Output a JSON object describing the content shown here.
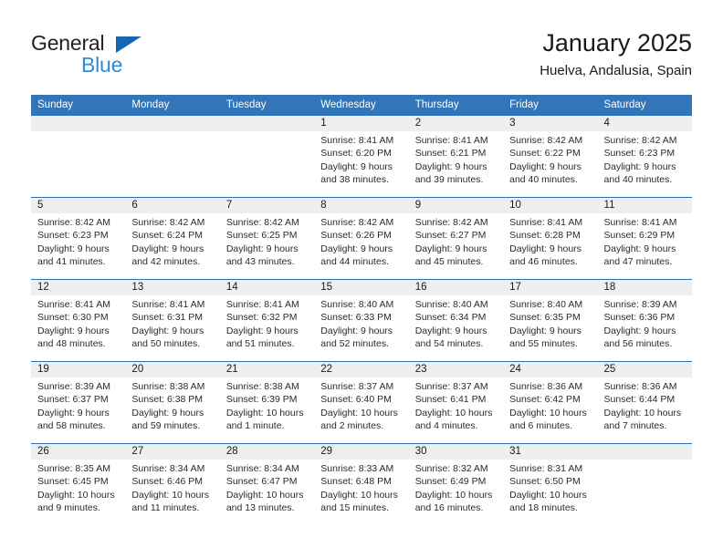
{
  "logo": {
    "primary_text": "General",
    "secondary_text": "Blue",
    "primary_color": "#231f20",
    "secondary_color": "#2e8bd4",
    "triangle_color": "#1567b3",
    "triangle_name": "blue-triangle-icon"
  },
  "header": {
    "title": "January 2025",
    "subtitle": "Huelva, Andalusia, Spain"
  },
  "colors": {
    "header_band": "#3275b8",
    "week_divider": "#2f6fae",
    "day_number_band": "#efefef"
  },
  "weekdays": [
    "Sunday",
    "Monday",
    "Tuesday",
    "Wednesday",
    "Thursday",
    "Friday",
    "Saturday"
  ],
  "weeks": [
    [
      {
        "day": "",
        "empty": true,
        "sunrise": "",
        "sunset": "",
        "daylight_line1": "",
        "daylight_line2": ""
      },
      {
        "day": "",
        "empty": true,
        "sunrise": "",
        "sunset": "",
        "daylight_line1": "",
        "daylight_line2": ""
      },
      {
        "day": "",
        "empty": true,
        "sunrise": "",
        "sunset": "",
        "daylight_line1": "",
        "daylight_line2": ""
      },
      {
        "day": "1",
        "empty": false,
        "sunrise": "Sunrise: 8:41 AM",
        "sunset": "Sunset: 6:20 PM",
        "daylight_line1": "Daylight: 9 hours",
        "daylight_line2": "and 38 minutes."
      },
      {
        "day": "2",
        "empty": false,
        "sunrise": "Sunrise: 8:41 AM",
        "sunset": "Sunset: 6:21 PM",
        "daylight_line1": "Daylight: 9 hours",
        "daylight_line2": "and 39 minutes."
      },
      {
        "day": "3",
        "empty": false,
        "sunrise": "Sunrise: 8:42 AM",
        "sunset": "Sunset: 6:22 PM",
        "daylight_line1": "Daylight: 9 hours",
        "daylight_line2": "and 40 minutes."
      },
      {
        "day": "4",
        "empty": false,
        "sunrise": "Sunrise: 8:42 AM",
        "sunset": "Sunset: 6:23 PM",
        "daylight_line1": "Daylight: 9 hours",
        "daylight_line2": "and 40 minutes."
      }
    ],
    [
      {
        "day": "5",
        "empty": false,
        "sunrise": "Sunrise: 8:42 AM",
        "sunset": "Sunset: 6:23 PM",
        "daylight_line1": "Daylight: 9 hours",
        "daylight_line2": "and 41 minutes."
      },
      {
        "day": "6",
        "empty": false,
        "sunrise": "Sunrise: 8:42 AM",
        "sunset": "Sunset: 6:24 PM",
        "daylight_line1": "Daylight: 9 hours",
        "daylight_line2": "and 42 minutes."
      },
      {
        "day": "7",
        "empty": false,
        "sunrise": "Sunrise: 8:42 AM",
        "sunset": "Sunset: 6:25 PM",
        "daylight_line1": "Daylight: 9 hours",
        "daylight_line2": "and 43 minutes."
      },
      {
        "day": "8",
        "empty": false,
        "sunrise": "Sunrise: 8:42 AM",
        "sunset": "Sunset: 6:26 PM",
        "daylight_line1": "Daylight: 9 hours",
        "daylight_line2": "and 44 minutes."
      },
      {
        "day": "9",
        "empty": false,
        "sunrise": "Sunrise: 8:42 AM",
        "sunset": "Sunset: 6:27 PM",
        "daylight_line1": "Daylight: 9 hours",
        "daylight_line2": "and 45 minutes."
      },
      {
        "day": "10",
        "empty": false,
        "sunrise": "Sunrise: 8:41 AM",
        "sunset": "Sunset: 6:28 PM",
        "daylight_line1": "Daylight: 9 hours",
        "daylight_line2": "and 46 minutes."
      },
      {
        "day": "11",
        "empty": false,
        "sunrise": "Sunrise: 8:41 AM",
        "sunset": "Sunset: 6:29 PM",
        "daylight_line1": "Daylight: 9 hours",
        "daylight_line2": "and 47 minutes."
      }
    ],
    [
      {
        "day": "12",
        "empty": false,
        "sunrise": "Sunrise: 8:41 AM",
        "sunset": "Sunset: 6:30 PM",
        "daylight_line1": "Daylight: 9 hours",
        "daylight_line2": "and 48 minutes."
      },
      {
        "day": "13",
        "empty": false,
        "sunrise": "Sunrise: 8:41 AM",
        "sunset": "Sunset: 6:31 PM",
        "daylight_line1": "Daylight: 9 hours",
        "daylight_line2": "and 50 minutes."
      },
      {
        "day": "14",
        "empty": false,
        "sunrise": "Sunrise: 8:41 AM",
        "sunset": "Sunset: 6:32 PM",
        "daylight_line1": "Daylight: 9 hours",
        "daylight_line2": "and 51 minutes."
      },
      {
        "day": "15",
        "empty": false,
        "sunrise": "Sunrise: 8:40 AM",
        "sunset": "Sunset: 6:33 PM",
        "daylight_line1": "Daylight: 9 hours",
        "daylight_line2": "and 52 minutes."
      },
      {
        "day": "16",
        "empty": false,
        "sunrise": "Sunrise: 8:40 AM",
        "sunset": "Sunset: 6:34 PM",
        "daylight_line1": "Daylight: 9 hours",
        "daylight_line2": "and 54 minutes."
      },
      {
        "day": "17",
        "empty": false,
        "sunrise": "Sunrise: 8:40 AM",
        "sunset": "Sunset: 6:35 PM",
        "daylight_line1": "Daylight: 9 hours",
        "daylight_line2": "and 55 minutes."
      },
      {
        "day": "18",
        "empty": false,
        "sunrise": "Sunrise: 8:39 AM",
        "sunset": "Sunset: 6:36 PM",
        "daylight_line1": "Daylight: 9 hours",
        "daylight_line2": "and 56 minutes."
      }
    ],
    [
      {
        "day": "19",
        "empty": false,
        "sunrise": "Sunrise: 8:39 AM",
        "sunset": "Sunset: 6:37 PM",
        "daylight_line1": "Daylight: 9 hours",
        "daylight_line2": "and 58 minutes."
      },
      {
        "day": "20",
        "empty": false,
        "sunrise": "Sunrise: 8:38 AM",
        "sunset": "Sunset: 6:38 PM",
        "daylight_line1": "Daylight: 9 hours",
        "daylight_line2": "and 59 minutes."
      },
      {
        "day": "21",
        "empty": false,
        "sunrise": "Sunrise: 8:38 AM",
        "sunset": "Sunset: 6:39 PM",
        "daylight_line1": "Daylight: 10 hours",
        "daylight_line2": "and 1 minute."
      },
      {
        "day": "22",
        "empty": false,
        "sunrise": "Sunrise: 8:37 AM",
        "sunset": "Sunset: 6:40 PM",
        "daylight_line1": "Daylight: 10 hours",
        "daylight_line2": "and 2 minutes."
      },
      {
        "day": "23",
        "empty": false,
        "sunrise": "Sunrise: 8:37 AM",
        "sunset": "Sunset: 6:41 PM",
        "daylight_line1": "Daylight: 10 hours",
        "daylight_line2": "and 4 minutes."
      },
      {
        "day": "24",
        "empty": false,
        "sunrise": "Sunrise: 8:36 AM",
        "sunset": "Sunset: 6:42 PM",
        "daylight_line1": "Daylight: 10 hours",
        "daylight_line2": "and 6 minutes."
      },
      {
        "day": "25",
        "empty": false,
        "sunrise": "Sunrise: 8:36 AM",
        "sunset": "Sunset: 6:44 PM",
        "daylight_line1": "Daylight: 10 hours",
        "daylight_line2": "and 7 minutes."
      }
    ],
    [
      {
        "day": "26",
        "empty": false,
        "sunrise": "Sunrise: 8:35 AM",
        "sunset": "Sunset: 6:45 PM",
        "daylight_line1": "Daylight: 10 hours",
        "daylight_line2": "and 9 minutes."
      },
      {
        "day": "27",
        "empty": false,
        "sunrise": "Sunrise: 8:34 AM",
        "sunset": "Sunset: 6:46 PM",
        "daylight_line1": "Daylight: 10 hours",
        "daylight_line2": "and 11 minutes."
      },
      {
        "day": "28",
        "empty": false,
        "sunrise": "Sunrise: 8:34 AM",
        "sunset": "Sunset: 6:47 PM",
        "daylight_line1": "Daylight: 10 hours",
        "daylight_line2": "and 13 minutes."
      },
      {
        "day": "29",
        "empty": false,
        "sunrise": "Sunrise: 8:33 AM",
        "sunset": "Sunset: 6:48 PM",
        "daylight_line1": "Daylight: 10 hours",
        "daylight_line2": "and 15 minutes."
      },
      {
        "day": "30",
        "empty": false,
        "sunrise": "Sunrise: 8:32 AM",
        "sunset": "Sunset: 6:49 PM",
        "daylight_line1": "Daylight: 10 hours",
        "daylight_line2": "and 16 minutes."
      },
      {
        "day": "31",
        "empty": false,
        "sunrise": "Sunrise: 8:31 AM",
        "sunset": "Sunset: 6:50 PM",
        "daylight_line1": "Daylight: 10 hours",
        "daylight_line2": "and 18 minutes."
      },
      {
        "day": "",
        "empty": true,
        "sunrise": "",
        "sunset": "",
        "daylight_line1": "",
        "daylight_line2": ""
      }
    ]
  ]
}
